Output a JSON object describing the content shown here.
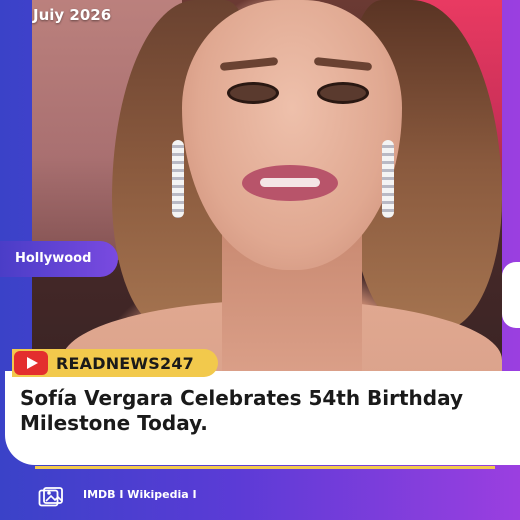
{
  "post": {
    "date": "Juiy 2026",
    "category": "Hollywood",
    "brand": "READNEWS247",
    "headline": "Sofía Vergara Celebrates 54th Birthday Milestone Today.",
    "footer": "IMDB I Wikipedia I"
  },
  "colors": {
    "frame_start": "#3a42c8",
    "frame_end": "#9b3fe0",
    "brand_yellow": "#f2c94c",
    "youtube_red": "#e32e2e"
  },
  "icons": {
    "brand": "youtube-icon",
    "footer": "gallery-icon"
  }
}
